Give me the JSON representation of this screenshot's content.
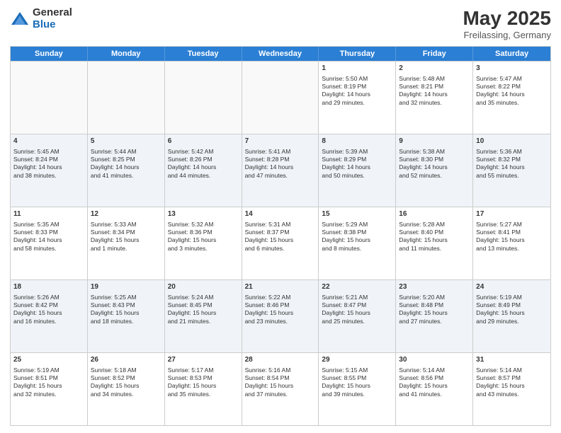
{
  "logo": {
    "general": "General",
    "blue": "Blue"
  },
  "title": {
    "month": "May 2025",
    "location": "Freilassing, Germany"
  },
  "weekdays": [
    "Sunday",
    "Monday",
    "Tuesday",
    "Wednesday",
    "Thursday",
    "Friday",
    "Saturday"
  ],
  "rows": [
    [
      {
        "day": "",
        "text": "",
        "empty": true
      },
      {
        "day": "",
        "text": "",
        "empty": true
      },
      {
        "day": "",
        "text": "",
        "empty": true
      },
      {
        "day": "",
        "text": "",
        "empty": true
      },
      {
        "day": "1",
        "text": "Sunrise: 5:50 AM\nSunset: 8:19 PM\nDaylight: 14 hours\nand 29 minutes.",
        "empty": false
      },
      {
        "day": "2",
        "text": "Sunrise: 5:48 AM\nSunset: 8:21 PM\nDaylight: 14 hours\nand 32 minutes.",
        "empty": false
      },
      {
        "day": "3",
        "text": "Sunrise: 5:47 AM\nSunset: 8:22 PM\nDaylight: 14 hours\nand 35 minutes.",
        "empty": false
      }
    ],
    [
      {
        "day": "4",
        "text": "Sunrise: 5:45 AM\nSunset: 8:24 PM\nDaylight: 14 hours\nand 38 minutes.",
        "empty": false
      },
      {
        "day": "5",
        "text": "Sunrise: 5:44 AM\nSunset: 8:25 PM\nDaylight: 14 hours\nand 41 minutes.",
        "empty": false
      },
      {
        "day": "6",
        "text": "Sunrise: 5:42 AM\nSunset: 8:26 PM\nDaylight: 14 hours\nand 44 minutes.",
        "empty": false
      },
      {
        "day": "7",
        "text": "Sunrise: 5:41 AM\nSunset: 8:28 PM\nDaylight: 14 hours\nand 47 minutes.",
        "empty": false
      },
      {
        "day": "8",
        "text": "Sunrise: 5:39 AM\nSunset: 8:29 PM\nDaylight: 14 hours\nand 50 minutes.",
        "empty": false
      },
      {
        "day": "9",
        "text": "Sunrise: 5:38 AM\nSunset: 8:30 PM\nDaylight: 14 hours\nand 52 minutes.",
        "empty": false
      },
      {
        "day": "10",
        "text": "Sunrise: 5:36 AM\nSunset: 8:32 PM\nDaylight: 14 hours\nand 55 minutes.",
        "empty": false
      }
    ],
    [
      {
        "day": "11",
        "text": "Sunrise: 5:35 AM\nSunset: 8:33 PM\nDaylight: 14 hours\nand 58 minutes.",
        "empty": false
      },
      {
        "day": "12",
        "text": "Sunrise: 5:33 AM\nSunset: 8:34 PM\nDaylight: 15 hours\nand 1 minute.",
        "empty": false
      },
      {
        "day": "13",
        "text": "Sunrise: 5:32 AM\nSunset: 8:36 PM\nDaylight: 15 hours\nand 3 minutes.",
        "empty": false
      },
      {
        "day": "14",
        "text": "Sunrise: 5:31 AM\nSunset: 8:37 PM\nDaylight: 15 hours\nand 6 minutes.",
        "empty": false
      },
      {
        "day": "15",
        "text": "Sunrise: 5:29 AM\nSunset: 8:38 PM\nDaylight: 15 hours\nand 8 minutes.",
        "empty": false
      },
      {
        "day": "16",
        "text": "Sunrise: 5:28 AM\nSunset: 8:40 PM\nDaylight: 15 hours\nand 11 minutes.",
        "empty": false
      },
      {
        "day": "17",
        "text": "Sunrise: 5:27 AM\nSunset: 8:41 PM\nDaylight: 15 hours\nand 13 minutes.",
        "empty": false
      }
    ],
    [
      {
        "day": "18",
        "text": "Sunrise: 5:26 AM\nSunset: 8:42 PM\nDaylight: 15 hours\nand 16 minutes.",
        "empty": false
      },
      {
        "day": "19",
        "text": "Sunrise: 5:25 AM\nSunset: 8:43 PM\nDaylight: 15 hours\nand 18 minutes.",
        "empty": false
      },
      {
        "day": "20",
        "text": "Sunrise: 5:24 AM\nSunset: 8:45 PM\nDaylight: 15 hours\nand 21 minutes.",
        "empty": false
      },
      {
        "day": "21",
        "text": "Sunrise: 5:22 AM\nSunset: 8:46 PM\nDaylight: 15 hours\nand 23 minutes.",
        "empty": false
      },
      {
        "day": "22",
        "text": "Sunrise: 5:21 AM\nSunset: 8:47 PM\nDaylight: 15 hours\nand 25 minutes.",
        "empty": false
      },
      {
        "day": "23",
        "text": "Sunrise: 5:20 AM\nSunset: 8:48 PM\nDaylight: 15 hours\nand 27 minutes.",
        "empty": false
      },
      {
        "day": "24",
        "text": "Sunrise: 5:19 AM\nSunset: 8:49 PM\nDaylight: 15 hours\nand 29 minutes.",
        "empty": false
      }
    ],
    [
      {
        "day": "25",
        "text": "Sunrise: 5:19 AM\nSunset: 8:51 PM\nDaylight: 15 hours\nand 32 minutes.",
        "empty": false
      },
      {
        "day": "26",
        "text": "Sunrise: 5:18 AM\nSunset: 8:52 PM\nDaylight: 15 hours\nand 34 minutes.",
        "empty": false
      },
      {
        "day": "27",
        "text": "Sunrise: 5:17 AM\nSunset: 8:53 PM\nDaylight: 15 hours\nand 35 minutes.",
        "empty": false
      },
      {
        "day": "28",
        "text": "Sunrise: 5:16 AM\nSunset: 8:54 PM\nDaylight: 15 hours\nand 37 minutes.",
        "empty": false
      },
      {
        "day": "29",
        "text": "Sunrise: 5:15 AM\nSunset: 8:55 PM\nDaylight: 15 hours\nand 39 minutes.",
        "empty": false
      },
      {
        "day": "30",
        "text": "Sunrise: 5:14 AM\nSunset: 8:56 PM\nDaylight: 15 hours\nand 41 minutes.",
        "empty": false
      },
      {
        "day": "31",
        "text": "Sunrise: 5:14 AM\nSunset: 8:57 PM\nDaylight: 15 hours\nand 43 minutes.",
        "empty": false
      }
    ]
  ]
}
